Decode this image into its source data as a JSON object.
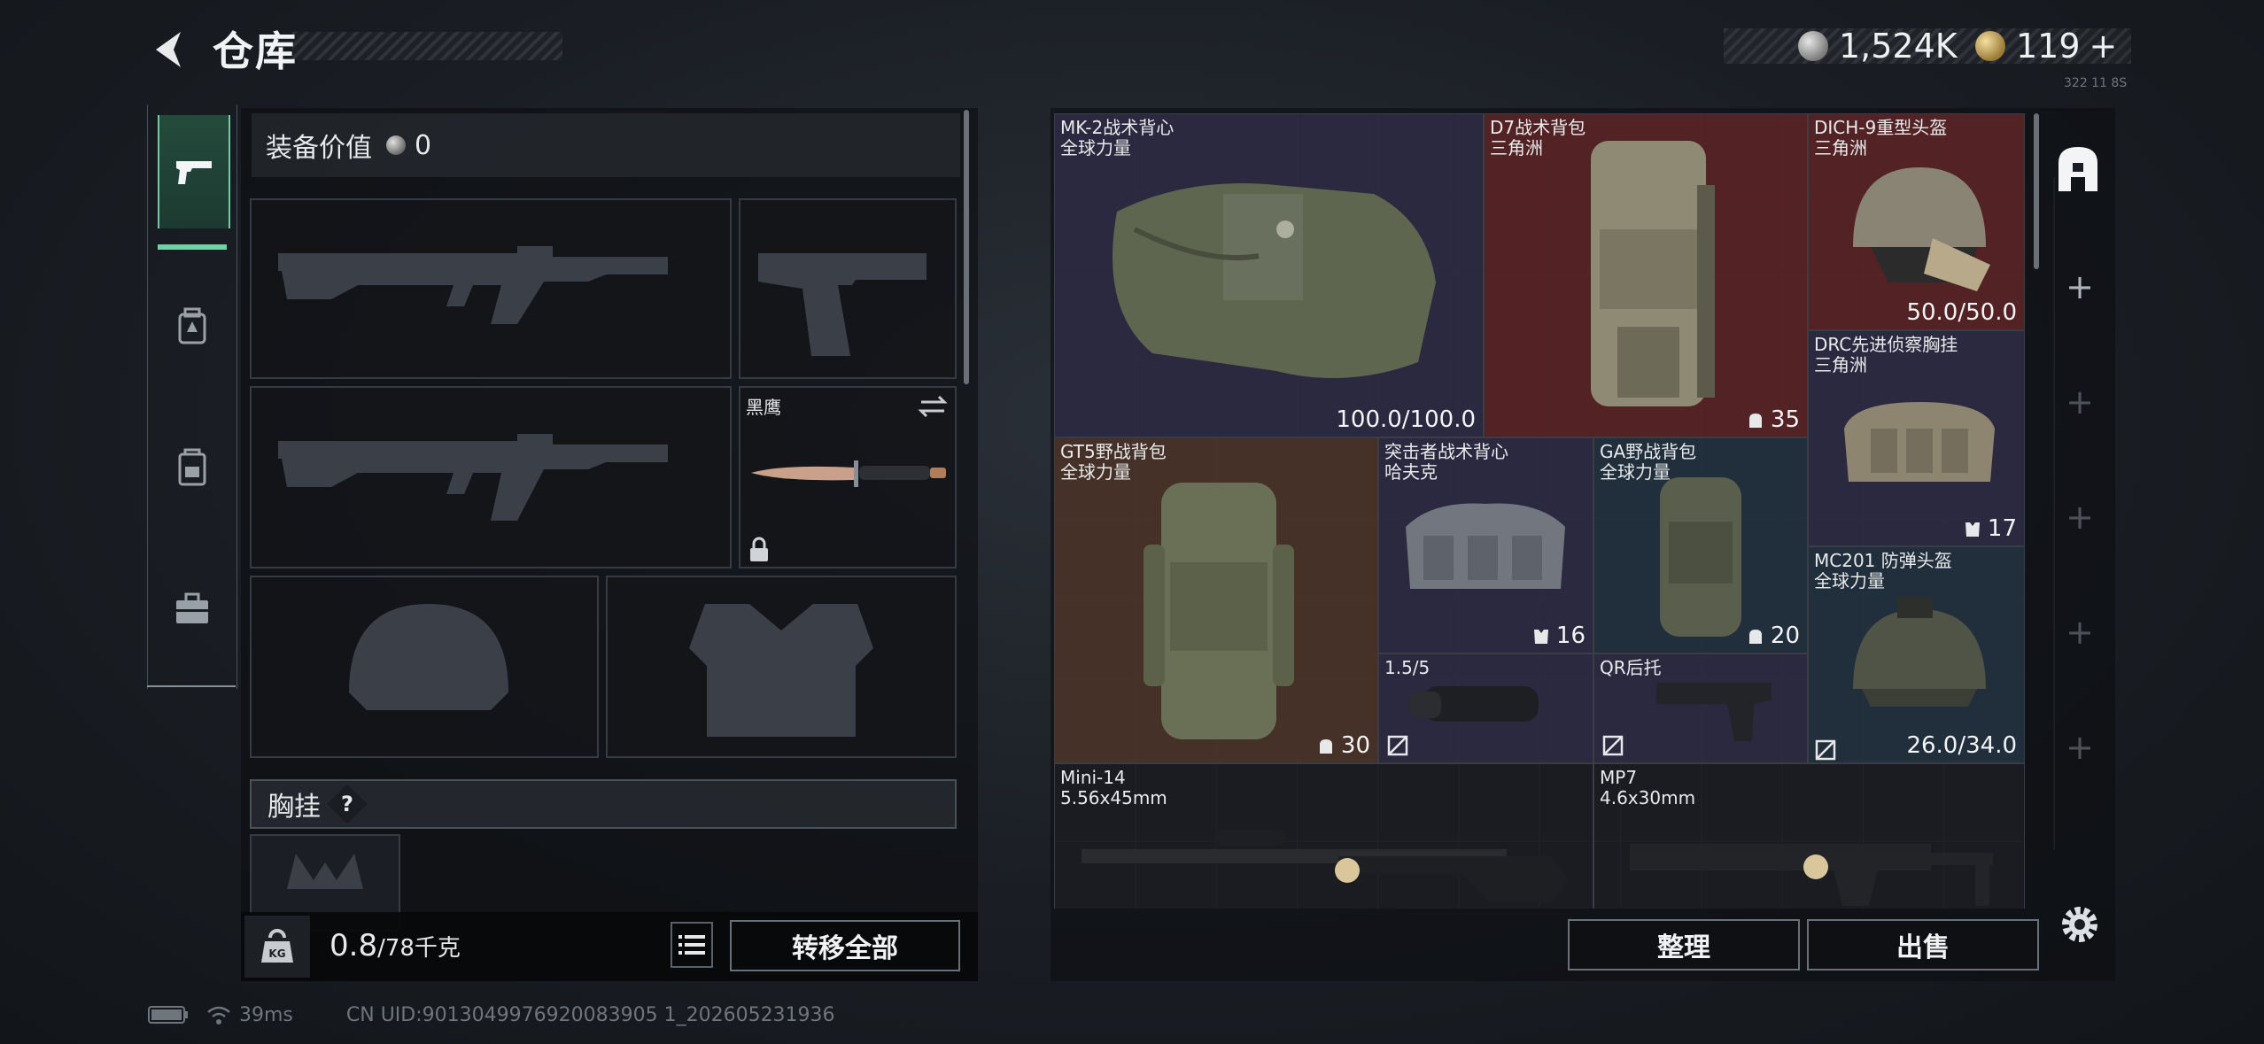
{
  "header": {
    "title": "仓库",
    "currency": [
      {
        "icon": "silver-coin-icon",
        "amount": "1,524K"
      },
      {
        "icon": "gold-coin-icon",
        "amount": "119"
      }
    ],
    "add_symbol": "+",
    "tiny_label": "322 11 8S"
  },
  "left": {
    "equip_value_label": "装备价值",
    "equip_value": "0",
    "melee_name": "黑鹰",
    "chest_label": "胸挂",
    "chest_help": "?",
    "weight_current": "0.8",
    "weight_max": "/78千克",
    "kg_icon_text": "KG",
    "transfer_all": "转移全部"
  },
  "tabs": [
    {
      "icon": "pistol-icon"
    },
    {
      "icon": "gear-bag-icon"
    },
    {
      "icon": "backpack-icon"
    },
    {
      "icon": "briefcase-icon"
    }
  ],
  "items": [
    {
      "name1": "MK-2战术背心",
      "name2": "全球力量",
      "value": "100.0/100.0"
    },
    {
      "name1": "D7战术背包",
      "name2": "三角洲",
      "value": "35"
    },
    {
      "name1": "DICH-9重型头盔",
      "name2": "三角洲",
      "value": "50.0/50.0"
    },
    {
      "name1": "DRC先进侦察胸挂",
      "name2": "三角洲",
      "value": "17"
    },
    {
      "name1": "GT5野战背包",
      "name2": "全球力量",
      "value": "30"
    },
    {
      "name1": "突击者战术背心",
      "name2": "哈夫克",
      "value": "16"
    },
    {
      "name1": "GA野战背包",
      "name2": "全球力量",
      "value": "20"
    },
    {
      "name1": "MC201 防弹头盔",
      "name2": "全球力量",
      "value": "26.0/34.0"
    },
    {
      "name1": "1.5/5",
      "name2": ""
    },
    {
      "name1": "QR后托",
      "name2": ""
    },
    {
      "name1": "Mini-14",
      "name2": "5.56x45mm"
    },
    {
      "name1": "MP7",
      "name2": "4.6x30mm"
    }
  ],
  "right": {
    "sort_button": "整理",
    "sell_button": "出售"
  },
  "status": {
    "ping": "39ms",
    "uid": "CN UID:9013049976920083905 1_202605231936"
  },
  "colors": {
    "accent_green": "#6fd2a6",
    "purple_item": "#2e2c44",
    "red_item": "#5a2426",
    "brown_item": "#4a3428",
    "blue_item": "#22313e"
  }
}
